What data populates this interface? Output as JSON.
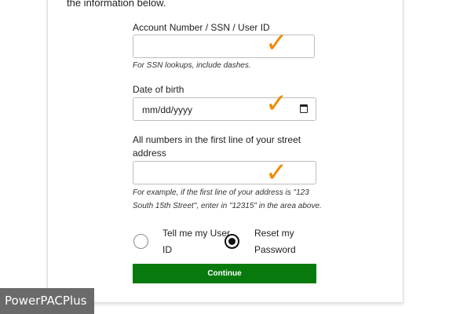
{
  "intro": {
    "text": "the information below."
  },
  "account_field": {
    "label": "Account Number / SSN / User ID",
    "value": "",
    "help": "For SSN lookups, include dashes."
  },
  "dob_field": {
    "label": "Date of birth",
    "placeholder": "mm/dd/yyyy",
    "icon": "calendar-icon"
  },
  "address_field": {
    "label_line1": "All numbers in the first line of your street",
    "label_line2": "address",
    "value": "",
    "help_line1": "For example, if the first line of your address is \"123",
    "help_line2": "South 15th Street\", enter in \"12315\" in the area above."
  },
  "options": {
    "user_id": {
      "line1": "Tell me my User",
      "line2": "ID",
      "selected": false
    },
    "password": {
      "line1": "Reset my",
      "line2": "Password",
      "selected": true
    }
  },
  "actions": {
    "continue_label": "Continue"
  },
  "annotations": {
    "checkmark_glyph": "✓",
    "checkmark_color": "#f08a00"
  },
  "watermark": {
    "text": "PowerPACPlus"
  },
  "colors": {
    "button": "#087a0d",
    "watermark_bg": "#6a6a6a"
  }
}
